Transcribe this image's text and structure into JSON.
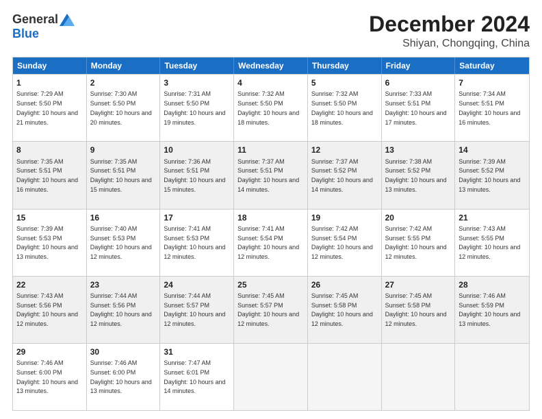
{
  "logo": {
    "general": "General",
    "blue": "Blue"
  },
  "title": "December 2024",
  "subtitle": "Shiyan, Chongqing, China",
  "days": [
    "Sunday",
    "Monday",
    "Tuesday",
    "Wednesday",
    "Thursday",
    "Friday",
    "Saturday"
  ],
  "rows": [
    [
      {
        "day": "1",
        "sunrise": "7:29 AM",
        "sunset": "5:50 PM",
        "daylight": "10 hours and 21 minutes."
      },
      {
        "day": "2",
        "sunrise": "7:30 AM",
        "sunset": "5:50 PM",
        "daylight": "10 hours and 20 minutes."
      },
      {
        "day": "3",
        "sunrise": "7:31 AM",
        "sunset": "5:50 PM",
        "daylight": "10 hours and 19 minutes."
      },
      {
        "day": "4",
        "sunrise": "7:32 AM",
        "sunset": "5:50 PM",
        "daylight": "10 hours and 18 minutes."
      },
      {
        "day": "5",
        "sunrise": "7:32 AM",
        "sunset": "5:50 PM",
        "daylight": "10 hours and 18 minutes."
      },
      {
        "day": "6",
        "sunrise": "7:33 AM",
        "sunset": "5:51 PM",
        "daylight": "10 hours and 17 minutes."
      },
      {
        "day": "7",
        "sunrise": "7:34 AM",
        "sunset": "5:51 PM",
        "daylight": "10 hours and 16 minutes."
      }
    ],
    [
      {
        "day": "8",
        "sunrise": "7:35 AM",
        "sunset": "5:51 PM",
        "daylight": "10 hours and 16 minutes."
      },
      {
        "day": "9",
        "sunrise": "7:35 AM",
        "sunset": "5:51 PM",
        "daylight": "10 hours and 15 minutes."
      },
      {
        "day": "10",
        "sunrise": "7:36 AM",
        "sunset": "5:51 PM",
        "daylight": "10 hours and 15 minutes."
      },
      {
        "day": "11",
        "sunrise": "7:37 AM",
        "sunset": "5:51 PM",
        "daylight": "10 hours and 14 minutes."
      },
      {
        "day": "12",
        "sunrise": "7:37 AM",
        "sunset": "5:52 PM",
        "daylight": "10 hours and 14 minutes."
      },
      {
        "day": "13",
        "sunrise": "7:38 AM",
        "sunset": "5:52 PM",
        "daylight": "10 hours and 13 minutes."
      },
      {
        "day": "14",
        "sunrise": "7:39 AM",
        "sunset": "5:52 PM",
        "daylight": "10 hours and 13 minutes."
      }
    ],
    [
      {
        "day": "15",
        "sunrise": "7:39 AM",
        "sunset": "5:53 PM",
        "daylight": "10 hours and 13 minutes."
      },
      {
        "day": "16",
        "sunrise": "7:40 AM",
        "sunset": "5:53 PM",
        "daylight": "10 hours and 12 minutes."
      },
      {
        "day": "17",
        "sunrise": "7:41 AM",
        "sunset": "5:53 PM",
        "daylight": "10 hours and 12 minutes."
      },
      {
        "day": "18",
        "sunrise": "7:41 AM",
        "sunset": "5:54 PM",
        "daylight": "10 hours and 12 minutes."
      },
      {
        "day": "19",
        "sunrise": "7:42 AM",
        "sunset": "5:54 PM",
        "daylight": "10 hours and 12 minutes."
      },
      {
        "day": "20",
        "sunrise": "7:42 AM",
        "sunset": "5:55 PM",
        "daylight": "10 hours and 12 minutes."
      },
      {
        "day": "21",
        "sunrise": "7:43 AM",
        "sunset": "5:55 PM",
        "daylight": "10 hours and 12 minutes."
      }
    ],
    [
      {
        "day": "22",
        "sunrise": "7:43 AM",
        "sunset": "5:56 PM",
        "daylight": "10 hours and 12 minutes."
      },
      {
        "day": "23",
        "sunrise": "7:44 AM",
        "sunset": "5:56 PM",
        "daylight": "10 hours and 12 minutes."
      },
      {
        "day": "24",
        "sunrise": "7:44 AM",
        "sunset": "5:57 PM",
        "daylight": "10 hours and 12 minutes."
      },
      {
        "day": "25",
        "sunrise": "7:45 AM",
        "sunset": "5:57 PM",
        "daylight": "10 hours and 12 minutes."
      },
      {
        "day": "26",
        "sunrise": "7:45 AM",
        "sunset": "5:58 PM",
        "daylight": "10 hours and 12 minutes."
      },
      {
        "day": "27",
        "sunrise": "7:45 AM",
        "sunset": "5:58 PM",
        "daylight": "10 hours and 12 minutes."
      },
      {
        "day": "28",
        "sunrise": "7:46 AM",
        "sunset": "5:59 PM",
        "daylight": "10 hours and 13 minutes."
      }
    ],
    [
      {
        "day": "29",
        "sunrise": "7:46 AM",
        "sunset": "6:00 PM",
        "daylight": "10 hours and 13 minutes."
      },
      {
        "day": "30",
        "sunrise": "7:46 AM",
        "sunset": "6:00 PM",
        "daylight": "10 hours and 13 minutes."
      },
      {
        "day": "31",
        "sunrise": "7:47 AM",
        "sunset": "6:01 PM",
        "daylight": "10 hours and 14 minutes."
      },
      null,
      null,
      null,
      null
    ]
  ]
}
